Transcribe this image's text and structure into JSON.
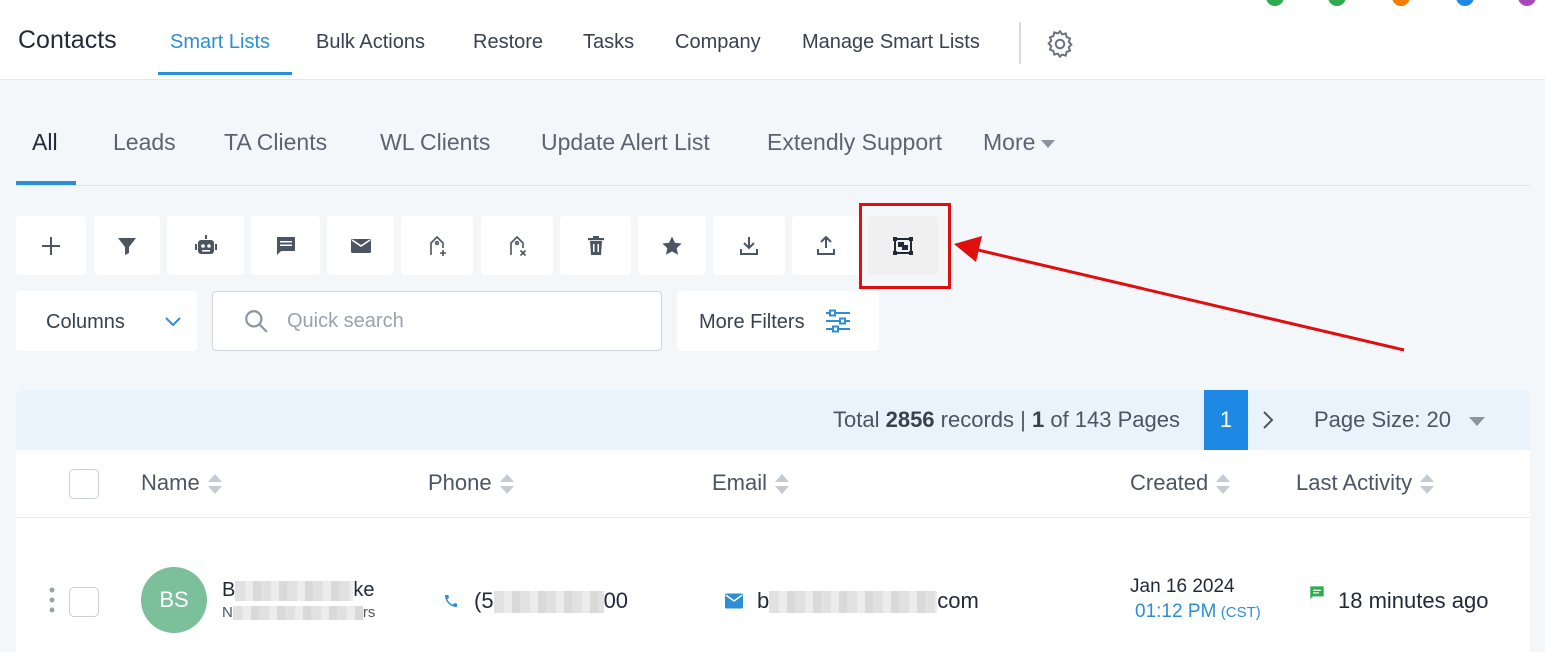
{
  "header": {
    "title": "Contacts",
    "nav": [
      {
        "label": "Smart Lists",
        "active": true
      },
      {
        "label": "Bulk Actions"
      },
      {
        "label": "Restore"
      },
      {
        "label": "Tasks"
      },
      {
        "label": "Company"
      },
      {
        "label": "Manage Smart Lists"
      }
    ],
    "settings_icon": "gear-icon",
    "status_dot_colors": [
      "#2eaa4f",
      "#2eaa4f",
      "#f57c00",
      "#1e88e5",
      "#ab47bc"
    ]
  },
  "tabs": [
    {
      "label": "All",
      "active": true
    },
    {
      "label": "Leads"
    },
    {
      "label": "TA Clients"
    },
    {
      "label": "WL Clients"
    },
    {
      "label": "Update Alert List"
    },
    {
      "label": "Extendly Support"
    },
    {
      "label": "More"
    }
  ],
  "toolbar": {
    "icons": [
      "plus-icon",
      "filter-icon",
      "robot-icon",
      "message-icon",
      "email-icon",
      "tag-add-icon",
      "tag-remove-icon",
      "trash-icon",
      "star-icon",
      "download-icon",
      "upload-icon",
      "merge-icon"
    ],
    "highlighted": "merge-icon"
  },
  "filters": {
    "columns_label": "Columns",
    "search_placeholder": "Quick search",
    "more_filters_label": "More Filters"
  },
  "pagination": {
    "total_prefix": "Total ",
    "total_records": "2856",
    "records_word": " records | ",
    "current_page": "1",
    "pages_suffix": " of 143 Pages",
    "page_size_label": "Page Size: 20"
  },
  "table": {
    "columns": [
      "Name",
      "Phone",
      "Email",
      "Created",
      "Last Activity"
    ],
    "rows": [
      {
        "initials": "BS",
        "name_start": "B",
        "name_end": "ke",
        "subtitle_start": "N",
        "subtitle_end": "rs",
        "phone_start": "(5",
        "phone_end": "00",
        "email_start": "b",
        "email_end": "com",
        "created_date": "Jan 16 2024",
        "created_time": "01:12 PM",
        "created_tz": "(CST)",
        "last_activity": "18 minutes ago"
      }
    ]
  },
  "colors": {
    "accent": "#2b8fd6",
    "highlight": "#e00f0f",
    "avatar": "#7cbf9b"
  }
}
